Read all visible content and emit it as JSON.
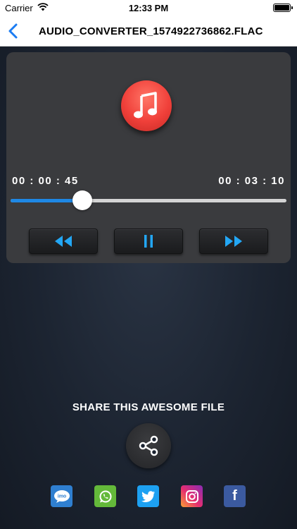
{
  "status_bar": {
    "carrier": "Carrier",
    "time": "12:33 PM"
  },
  "nav": {
    "title": "AUDIO_CONVERTER_1574922736862.FLAC",
    "back_icon": "chevron-left-icon"
  },
  "player": {
    "elapsed": "00 : 00 : 45",
    "total": "00 : 03 : 10",
    "progress": 0.26,
    "logo_icon": "music-note-icon",
    "controls": {
      "rewind_icon": "rewind-icon",
      "pause_icon": "pause-icon",
      "forward_icon": "fast-forward-icon"
    }
  },
  "share": {
    "heading": "SHARE THIS AWESOME FILE",
    "share_icon": "share-icon",
    "social": [
      {
        "name": "imo",
        "icon": "imo-icon",
        "label": "imo"
      },
      {
        "name": "whatsapp",
        "icon": "whatsapp-icon"
      },
      {
        "name": "twitter",
        "icon": "twitter-icon"
      },
      {
        "name": "instagram",
        "icon": "instagram-icon"
      },
      {
        "name": "facebook",
        "icon": "facebook-icon",
        "label": "f"
      }
    ]
  },
  "colors": {
    "accent": "#1e88e5",
    "nav_back": "#1b7cf2",
    "logo_red": "#f0403a",
    "control_icon": "#23a7f5"
  }
}
